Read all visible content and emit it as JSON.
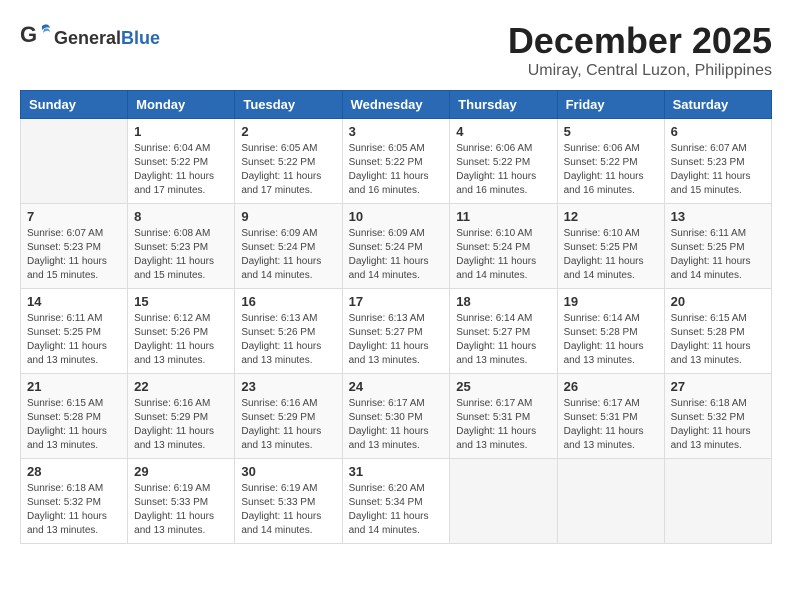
{
  "header": {
    "logo_general": "General",
    "logo_blue": "Blue",
    "month_year": "December 2025",
    "location": "Umiray, Central Luzon, Philippines"
  },
  "weekdays": [
    "Sunday",
    "Monday",
    "Tuesday",
    "Wednesday",
    "Thursday",
    "Friday",
    "Saturday"
  ],
  "weeks": [
    [
      {
        "day": "",
        "sunrise": "",
        "sunset": "",
        "daylight": ""
      },
      {
        "day": "1",
        "sunrise": "Sunrise: 6:04 AM",
        "sunset": "Sunset: 5:22 PM",
        "daylight": "Daylight: 11 hours and 17 minutes."
      },
      {
        "day": "2",
        "sunrise": "Sunrise: 6:05 AM",
        "sunset": "Sunset: 5:22 PM",
        "daylight": "Daylight: 11 hours and 17 minutes."
      },
      {
        "day": "3",
        "sunrise": "Sunrise: 6:05 AM",
        "sunset": "Sunset: 5:22 PM",
        "daylight": "Daylight: 11 hours and 16 minutes."
      },
      {
        "day": "4",
        "sunrise": "Sunrise: 6:06 AM",
        "sunset": "Sunset: 5:22 PM",
        "daylight": "Daylight: 11 hours and 16 minutes."
      },
      {
        "day": "5",
        "sunrise": "Sunrise: 6:06 AM",
        "sunset": "Sunset: 5:22 PM",
        "daylight": "Daylight: 11 hours and 16 minutes."
      },
      {
        "day": "6",
        "sunrise": "Sunrise: 6:07 AM",
        "sunset": "Sunset: 5:23 PM",
        "daylight": "Daylight: 11 hours and 15 minutes."
      }
    ],
    [
      {
        "day": "7",
        "sunrise": "Sunrise: 6:07 AM",
        "sunset": "Sunset: 5:23 PM",
        "daylight": "Daylight: 11 hours and 15 minutes."
      },
      {
        "day": "8",
        "sunrise": "Sunrise: 6:08 AM",
        "sunset": "Sunset: 5:23 PM",
        "daylight": "Daylight: 11 hours and 15 minutes."
      },
      {
        "day": "9",
        "sunrise": "Sunrise: 6:09 AM",
        "sunset": "Sunset: 5:24 PM",
        "daylight": "Daylight: 11 hours and 14 minutes."
      },
      {
        "day": "10",
        "sunrise": "Sunrise: 6:09 AM",
        "sunset": "Sunset: 5:24 PM",
        "daylight": "Daylight: 11 hours and 14 minutes."
      },
      {
        "day": "11",
        "sunrise": "Sunrise: 6:10 AM",
        "sunset": "Sunset: 5:24 PM",
        "daylight": "Daylight: 11 hours and 14 minutes."
      },
      {
        "day": "12",
        "sunrise": "Sunrise: 6:10 AM",
        "sunset": "Sunset: 5:25 PM",
        "daylight": "Daylight: 11 hours and 14 minutes."
      },
      {
        "day": "13",
        "sunrise": "Sunrise: 6:11 AM",
        "sunset": "Sunset: 5:25 PM",
        "daylight": "Daylight: 11 hours and 14 minutes."
      }
    ],
    [
      {
        "day": "14",
        "sunrise": "Sunrise: 6:11 AM",
        "sunset": "Sunset: 5:25 PM",
        "daylight": "Daylight: 11 hours and 13 minutes."
      },
      {
        "day": "15",
        "sunrise": "Sunrise: 6:12 AM",
        "sunset": "Sunset: 5:26 PM",
        "daylight": "Daylight: 11 hours and 13 minutes."
      },
      {
        "day": "16",
        "sunrise": "Sunrise: 6:13 AM",
        "sunset": "Sunset: 5:26 PM",
        "daylight": "Daylight: 11 hours and 13 minutes."
      },
      {
        "day": "17",
        "sunrise": "Sunrise: 6:13 AM",
        "sunset": "Sunset: 5:27 PM",
        "daylight": "Daylight: 11 hours and 13 minutes."
      },
      {
        "day": "18",
        "sunrise": "Sunrise: 6:14 AM",
        "sunset": "Sunset: 5:27 PM",
        "daylight": "Daylight: 11 hours and 13 minutes."
      },
      {
        "day": "19",
        "sunrise": "Sunrise: 6:14 AM",
        "sunset": "Sunset: 5:28 PM",
        "daylight": "Daylight: 11 hours and 13 minutes."
      },
      {
        "day": "20",
        "sunrise": "Sunrise: 6:15 AM",
        "sunset": "Sunset: 5:28 PM",
        "daylight": "Daylight: 11 hours and 13 minutes."
      }
    ],
    [
      {
        "day": "21",
        "sunrise": "Sunrise: 6:15 AM",
        "sunset": "Sunset: 5:28 PM",
        "daylight": "Daylight: 11 hours and 13 minutes."
      },
      {
        "day": "22",
        "sunrise": "Sunrise: 6:16 AM",
        "sunset": "Sunset: 5:29 PM",
        "daylight": "Daylight: 11 hours and 13 minutes."
      },
      {
        "day": "23",
        "sunrise": "Sunrise: 6:16 AM",
        "sunset": "Sunset: 5:29 PM",
        "daylight": "Daylight: 11 hours and 13 minutes."
      },
      {
        "day": "24",
        "sunrise": "Sunrise: 6:17 AM",
        "sunset": "Sunset: 5:30 PM",
        "daylight": "Daylight: 11 hours and 13 minutes."
      },
      {
        "day": "25",
        "sunrise": "Sunrise: 6:17 AM",
        "sunset": "Sunset: 5:31 PM",
        "daylight": "Daylight: 11 hours and 13 minutes."
      },
      {
        "day": "26",
        "sunrise": "Sunrise: 6:17 AM",
        "sunset": "Sunset: 5:31 PM",
        "daylight": "Daylight: 11 hours and 13 minutes."
      },
      {
        "day": "27",
        "sunrise": "Sunrise: 6:18 AM",
        "sunset": "Sunset: 5:32 PM",
        "daylight": "Daylight: 11 hours and 13 minutes."
      }
    ],
    [
      {
        "day": "28",
        "sunrise": "Sunrise: 6:18 AM",
        "sunset": "Sunset: 5:32 PM",
        "daylight": "Daylight: 11 hours and 13 minutes."
      },
      {
        "day": "29",
        "sunrise": "Sunrise: 6:19 AM",
        "sunset": "Sunset: 5:33 PM",
        "daylight": "Daylight: 11 hours and 13 minutes."
      },
      {
        "day": "30",
        "sunrise": "Sunrise: 6:19 AM",
        "sunset": "Sunset: 5:33 PM",
        "daylight": "Daylight: 11 hours and 14 minutes."
      },
      {
        "day": "31",
        "sunrise": "Sunrise: 6:20 AM",
        "sunset": "Sunset: 5:34 PM",
        "daylight": "Daylight: 11 hours and 14 minutes."
      },
      {
        "day": "",
        "sunrise": "",
        "sunset": "",
        "daylight": ""
      },
      {
        "day": "",
        "sunrise": "",
        "sunset": "",
        "daylight": ""
      },
      {
        "day": "",
        "sunrise": "",
        "sunset": "",
        "daylight": ""
      }
    ]
  ]
}
